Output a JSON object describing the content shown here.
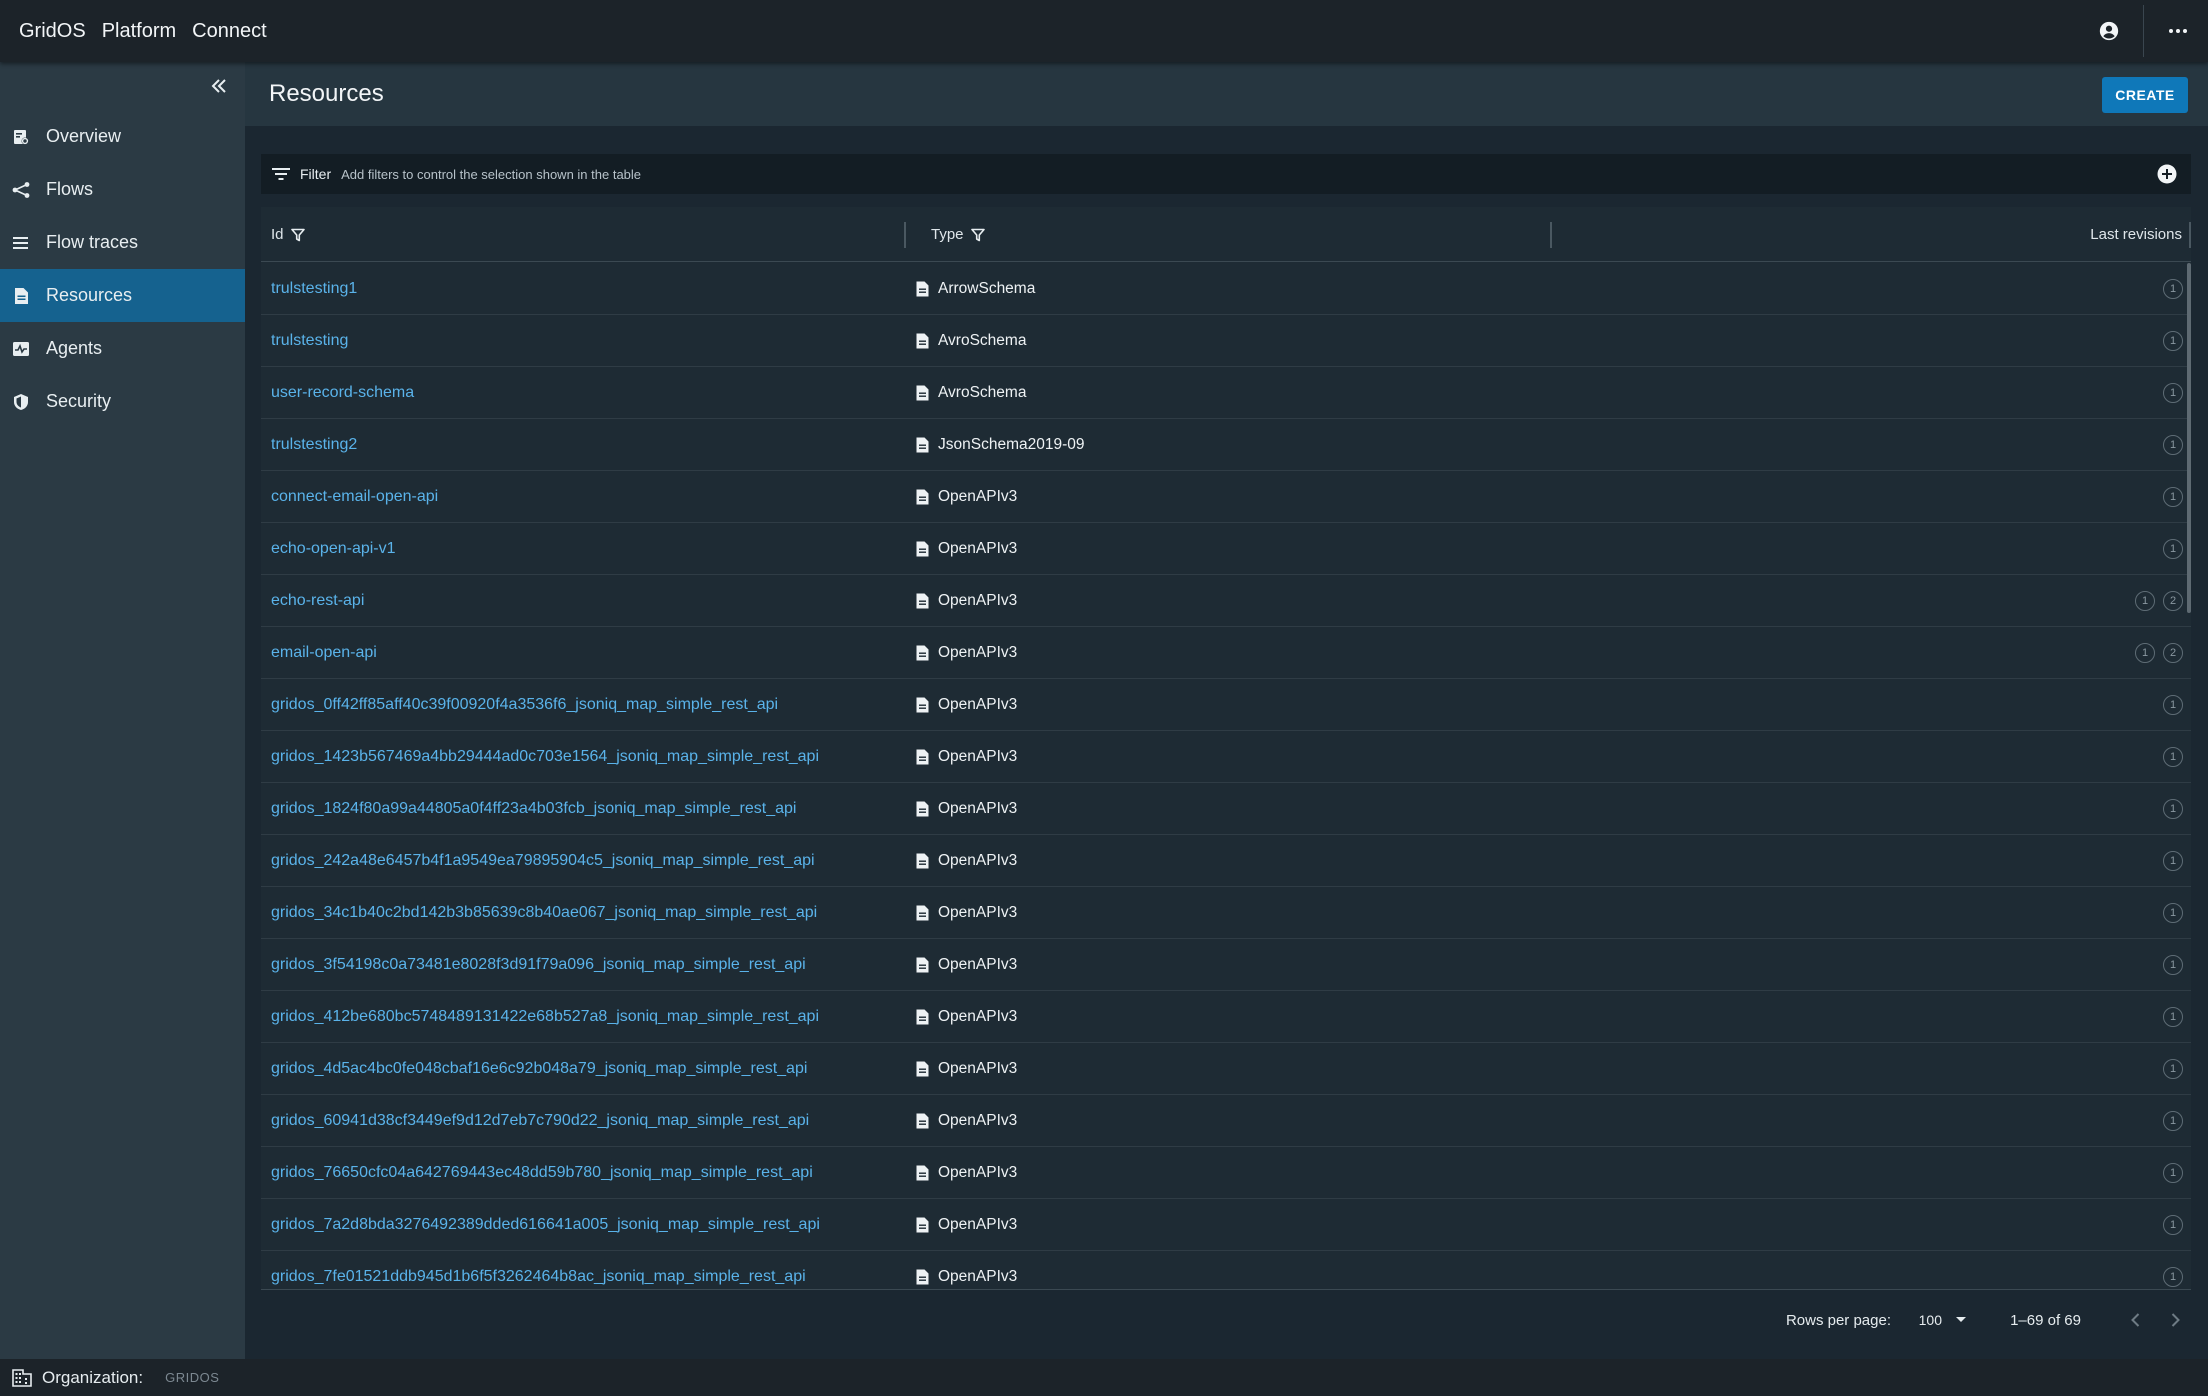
{
  "topbar": {
    "brand": [
      "GridOS",
      "Platform",
      "Connect"
    ],
    "account_icon": "account-circle-icon",
    "more_icon": "more-horizontal-icon"
  },
  "sidebar": {
    "collapse_icon": "double-chevron-left-icon",
    "items": [
      {
        "label": "Overview",
        "icon": "overview-icon",
        "active": false
      },
      {
        "label": "Flows",
        "icon": "flows-icon",
        "active": false
      },
      {
        "label": "Flow traces",
        "icon": "list-icon",
        "active": false
      },
      {
        "label": "Resources",
        "icon": "document-icon",
        "active": true
      },
      {
        "label": "Agents",
        "icon": "agents-icon",
        "active": false
      },
      {
        "label": "Security",
        "icon": "shield-icon",
        "active": false
      }
    ]
  },
  "page": {
    "title": "Resources",
    "create_label": "CREATE"
  },
  "filter": {
    "label": "Filter",
    "hint": "Add filters to control the selection shown in the table"
  },
  "table": {
    "columns": {
      "id": "Id",
      "type": "Type",
      "revisions": "Last revisions"
    },
    "rows": [
      {
        "id": "trulstesting1",
        "type": "ArrowSchema",
        "revisions": [
          "1"
        ]
      },
      {
        "id": "trulstesting",
        "type": "AvroSchema",
        "revisions": [
          "1"
        ]
      },
      {
        "id": "user-record-schema",
        "type": "AvroSchema",
        "revisions": [
          "1"
        ]
      },
      {
        "id": "trulstesting2",
        "type": "JsonSchema2019-09",
        "revisions": [
          "1"
        ]
      },
      {
        "id": "connect-email-open-api",
        "type": "OpenAPIv3",
        "revisions": [
          "1"
        ]
      },
      {
        "id": "echo-open-api-v1",
        "type": "OpenAPIv3",
        "revisions": [
          "1"
        ]
      },
      {
        "id": "echo-rest-api",
        "type": "OpenAPIv3",
        "revisions": [
          "1",
          "2"
        ]
      },
      {
        "id": "email-open-api",
        "type": "OpenAPIv3",
        "revisions": [
          "1",
          "2"
        ]
      },
      {
        "id": "gridos_0ff42ff85aff40c39f00920f4a3536f6_jsoniq_map_simple_rest_api",
        "type": "OpenAPIv3",
        "revisions": [
          "1"
        ]
      },
      {
        "id": "gridos_1423b567469a4bb29444ad0c703e1564_jsoniq_map_simple_rest_api",
        "type": "OpenAPIv3",
        "revisions": [
          "1"
        ]
      },
      {
        "id": "gridos_1824f80a99a44805a0f4ff23a4b03fcb_jsoniq_map_simple_rest_api",
        "type": "OpenAPIv3",
        "revisions": [
          "1"
        ]
      },
      {
        "id": "gridos_242a48e6457b4f1a9549ea79895904c5_jsoniq_map_simple_rest_api",
        "type": "OpenAPIv3",
        "revisions": [
          "1"
        ]
      },
      {
        "id": "gridos_34c1b40c2bd142b3b85639c8b40ae067_jsoniq_map_simple_rest_api",
        "type": "OpenAPIv3",
        "revisions": [
          "1"
        ]
      },
      {
        "id": "gridos_3f54198c0a73481e8028f3d91f79a096_jsoniq_map_simple_rest_api",
        "type": "OpenAPIv3",
        "revisions": [
          "1"
        ]
      },
      {
        "id": "gridos_412be680bc5748489131422e68b527a8_jsoniq_map_simple_rest_api",
        "type": "OpenAPIv3",
        "revisions": [
          "1"
        ]
      },
      {
        "id": "gridos_4d5ac4bc0fe048cbaf16e6c92b048a79_jsoniq_map_simple_rest_api",
        "type": "OpenAPIv3",
        "revisions": [
          "1"
        ]
      },
      {
        "id": "gridos_60941d38cf3449ef9d12d7eb7c790d22_jsoniq_map_simple_rest_api",
        "type": "OpenAPIv3",
        "revisions": [
          "1"
        ]
      },
      {
        "id": "gridos_76650cfc04a642769443ec48dd59b780_jsoniq_map_simple_rest_api",
        "type": "OpenAPIv3",
        "revisions": [
          "1"
        ]
      },
      {
        "id": "gridos_7a2d8bda3276492389dded616641a005_jsoniq_map_simple_rest_api",
        "type": "OpenAPIv3",
        "revisions": [
          "1"
        ]
      },
      {
        "id": "gridos_7fe01521ddb945d1b6f5f3262464b8ac_jsoniq_map_simple_rest_api",
        "type": "OpenAPIv3",
        "revisions": [
          "1"
        ]
      }
    ]
  },
  "pagination": {
    "rows_per_page_label": "Rows per page:",
    "rows_per_page_value": "100",
    "range": "1–69 of 69"
  },
  "footer": {
    "org_label": "Organization:",
    "org_value": "GRIDOS"
  },
  "colors": {
    "accent": "#15628f",
    "button": "#0f78b9",
    "link": "#5ab3ea"
  }
}
